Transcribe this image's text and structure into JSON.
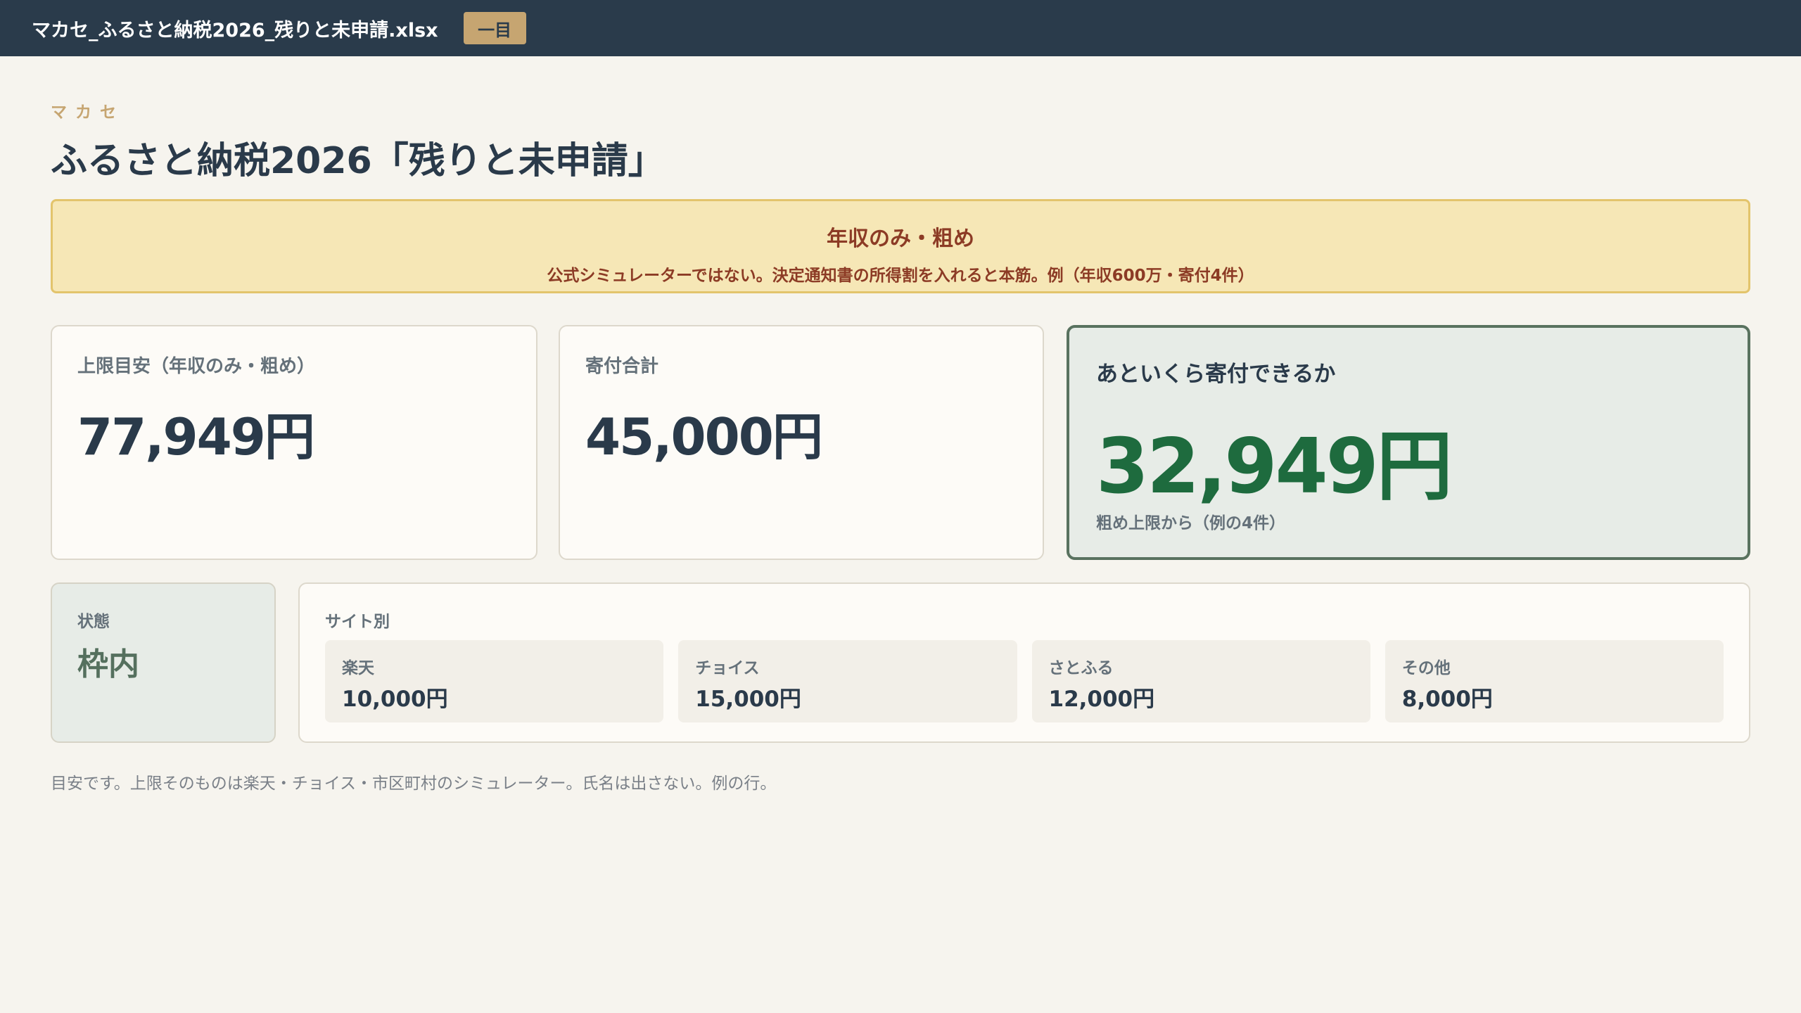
{
  "window": {
    "filename": "マカセ_ふるさと納税2026_残りと未申請.xlsx",
    "view_badge": "一目"
  },
  "header": {
    "brand": "マカセ",
    "title": "ふるさと納税2026「残りと未申請」"
  },
  "notice": {
    "headline": "年収のみ・粗め",
    "detail": "公式シミュレーターではない。決定通知書の所得割を入れると本筋。例（年収600万・寄付4件）"
  },
  "summary": {
    "limit_label": "上限目安（年収のみ・粗め）",
    "limit_value": "77,949円",
    "donation_label": "寄付合計",
    "donation_value": "45,000円",
    "remaining_label": "あといくら寄付できるか",
    "remaining_value": "32,949円",
    "remaining_note": "粗め上限から（例の4件）"
  },
  "status": {
    "label": "状態",
    "value": "枠内"
  },
  "sites": {
    "label": "サイト別",
    "items": [
      {
        "name": "楽天",
        "amount": "10,000円"
      },
      {
        "name": "チョイス",
        "amount": "15,000円"
      },
      {
        "name": "さとふる",
        "amount": "12,000円"
      },
      {
        "name": "その他",
        "amount": "8,000円"
      }
    ]
  },
  "footnote": "目安です。上限そのものは楽天・チョイス・市区町村のシミュレーター。氏名は出さない。例の行。",
  "colors": {
    "titlebar": "#2a3b4b",
    "accent_gold": "#c6a571",
    "notice_bg": "#f6e7b6",
    "notice_text": "#8c3b25",
    "remaining_green": "#1e6b3e",
    "status_green": "#55705e"
  }
}
